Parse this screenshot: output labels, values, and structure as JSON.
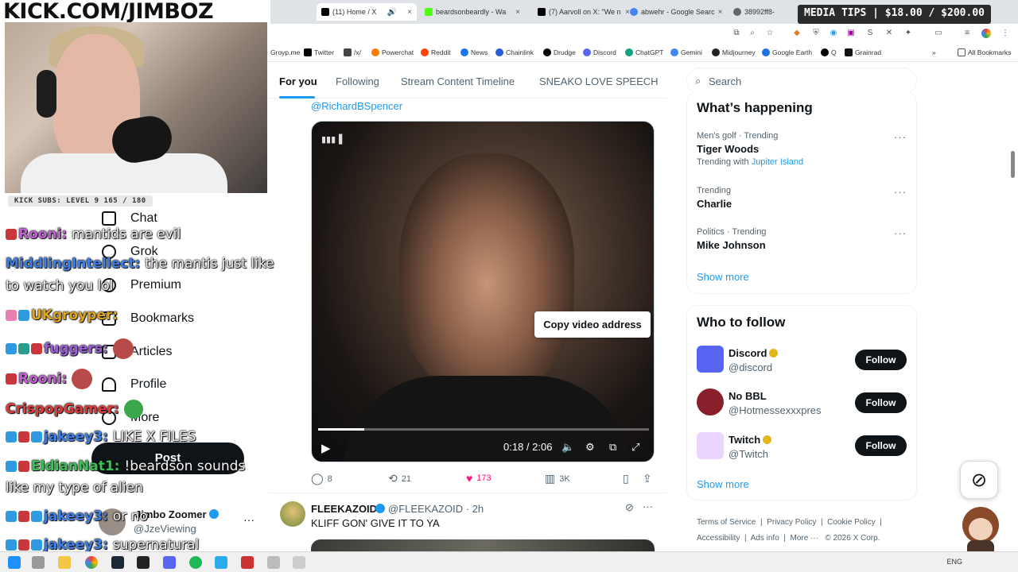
{
  "stream": {
    "kick_banner": "KICK.COM/JIMBOZ",
    "kick_subs": "KICK SUBS: LEVEL 9 165 / 180",
    "media_tips": "MEDIA TIPS | $18.00 / $200.00"
  },
  "browser": {
    "tabs": [
      {
        "label": "(11) Home / X",
        "active": true,
        "favicon_color": "#000000"
      },
      {
        "label": "beardsonbeardly - Wa",
        "active": false,
        "favicon_color": "#53fc18"
      },
      {
        "label": "(7) Aarvoll on X: \"We n",
        "active": false,
        "favicon_color": "#000000"
      },
      {
        "label": "abwehr - Google Searc",
        "active": false,
        "favicon_color": "#4285f4"
      },
      {
        "label": "38992ff8-",
        "active": false,
        "favicon_color": "#666666"
      }
    ],
    "bookmarks": [
      {
        "label": "Groyp.me",
        "color": "#888888"
      },
      {
        "label": "Twitter",
        "color": "#000000"
      },
      {
        "label": "/x/",
        "color": "#444444"
      },
      {
        "label": "Powerchat",
        "color": "#ff7a00"
      },
      {
        "label": "Reddit",
        "color": "#ff4500"
      },
      {
        "label": "News",
        "color": "#1a73e8"
      },
      {
        "label": "Chainlink",
        "color": "#2a5ada"
      },
      {
        "label": "Drudge",
        "color": "#000000"
      },
      {
        "label": "Discord",
        "color": "#5865f2"
      },
      {
        "label": "ChatGPT",
        "color": "#10a37f"
      },
      {
        "label": "Gemini",
        "color": "#4285f4"
      },
      {
        "label": "Midjourney",
        "color": "#222222"
      },
      {
        "label": "Google Earth",
        "color": "#1a73e8"
      },
      {
        "label": "Q",
        "color": "#000000"
      },
      {
        "label": "Grainrad",
        "color": "#111111"
      }
    ],
    "all_bookmarks": "All Bookmarks"
  },
  "nav": {
    "items": [
      "Chat",
      "Grok",
      "Premium",
      "Bookmarks",
      "Articles",
      "Profile",
      "More"
    ],
    "post": "Post",
    "account_name": "Jimbo Zoomer",
    "account_handle": "@JzeViewing"
  },
  "chat": [
    {
      "user": "Rooni:",
      "msg": "mantids are evil",
      "user_color": "#c55fd6"
    },
    {
      "user": "MiddlingIntellect:",
      "msg": "the mantis just like",
      "user_color": "#3f7fe3"
    },
    {
      "user": "",
      "msg": "to watch you lol",
      "user_color": "#ffffff"
    },
    {
      "user": "UKgroyper:",
      "msg": "",
      "user_color": "#e0a51a"
    },
    {
      "user": "fuggers:",
      "msg": "",
      "user_color": "#9a5fd6"
    },
    {
      "user": "Rooni:",
      "msg": "",
      "user_color": "#c55fd6"
    },
    {
      "user": "CrispopGamer:",
      "msg": "",
      "user_color": "#e23a3a"
    },
    {
      "user": "jakeey3:",
      "msg": "LIKE X FILES",
      "user_color": "#3f7fe3"
    },
    {
      "user": "EldianNat1:",
      "msg": "!beardson sounds",
      "user_color": "#3fbf5a"
    },
    {
      "user": "",
      "msg": "like my type of alien",
      "user_color": "#ffffff"
    },
    {
      "user": "jakeey3:",
      "msg": "or no",
      "user_color": "#3f7fe3"
    },
    {
      "user": "jakeey3:",
      "msg": "supernatural",
      "user_color": "#3f7fe3"
    }
  ],
  "main": {
    "tabs": [
      "For you",
      "Following",
      "Stream Content Timeline",
      "SNEAKO LOVE SPEECH"
    ],
    "mention": "@RichardBSpencer",
    "video": {
      "time": "0:18 / 2:06",
      "progress": 0.14,
      "tooltip": "Copy video address"
    },
    "actions": {
      "replies": "8",
      "reposts": "21",
      "likes": "173",
      "views": "3K"
    },
    "tweet2": {
      "name": "FLEEKAZOID",
      "handle": "@FLEEKAZOID · 2h",
      "text": "KLIFF GON' GIVE IT TO YA"
    }
  },
  "sidebar": {
    "search_placeholder": "Search",
    "happening_title": "What’s happening",
    "trends": [
      {
        "meta": "Men's golf · Trending",
        "topic": "Tiger Woods",
        "sub_prefix": "Trending with",
        "sub_link": "Jupiter Island"
      },
      {
        "meta": "Trending",
        "topic": "Charlie",
        "sub_prefix": "",
        "sub_link": ""
      },
      {
        "meta": "Politics · Trending",
        "topic": "Mike Johnson",
        "sub_prefix": "",
        "sub_link": ""
      }
    ],
    "show_more": "Show more",
    "who_title": "Who to follow",
    "who": [
      {
        "name": "Discord",
        "handle": "@discord",
        "avatar_color": "#5865f2",
        "verified": true
      },
      {
        "name": "No BBL",
        "handle": "@Hotmessexxxpres",
        "avatar_color": "#8a1f2c",
        "verified": false
      },
      {
        "name": "Twitch",
        "handle": "@Twitch",
        "avatar_color": "#e9d5ff",
        "verified": true
      }
    ],
    "follow_label": "Follow",
    "show_more_2": "Show more",
    "footer": [
      "Terms of Service",
      "Privacy Policy",
      "Cookie Policy",
      "Accessibility",
      "Ads info",
      "More ···",
      "© 2026 X Corp."
    ]
  },
  "taskbar": {
    "tray_text": "ENG"
  }
}
